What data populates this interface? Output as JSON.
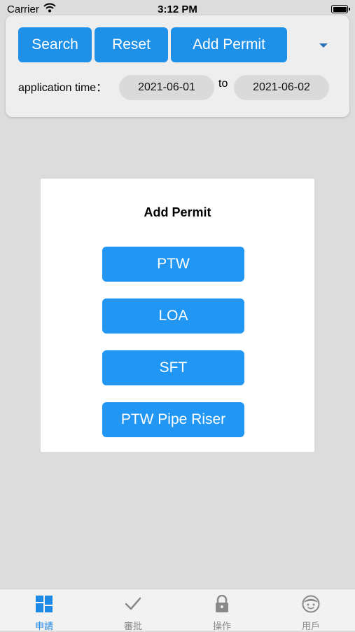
{
  "status_bar": {
    "carrier": "Carrier",
    "time": "3:12 PM"
  },
  "toolbar": {
    "search_label": "Search",
    "reset_label": "Reset",
    "add_permit_label": "Add Permit",
    "application_time_label": "application time：",
    "date_from": "2021-06-01",
    "to_label": "to",
    "date_to": "2021-06-02"
  },
  "modal": {
    "title": "Add Permit",
    "options": [
      "PTW",
      "LOA",
      "SFT",
      "PTW Pipe Riser"
    ]
  },
  "tabs": [
    {
      "label": "申請",
      "icon": "grid-icon",
      "active": true
    },
    {
      "label": "審批",
      "icon": "checkmark-icon",
      "active": false
    },
    {
      "label": "操作",
      "icon": "lock-icon",
      "active": false
    },
    {
      "label": "用戶",
      "icon": "user-face-icon",
      "active": false
    }
  ],
  "colors": {
    "accent": "#1e90e8",
    "tab_active": "#1e88e5",
    "tab_inactive": "#8a8a8a",
    "background": "#dcdcdc"
  }
}
